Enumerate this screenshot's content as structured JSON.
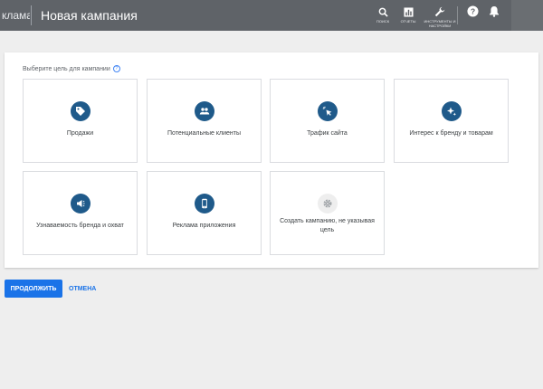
{
  "header": {
    "brand_partial": "клама",
    "title": "Новая кампания",
    "tools": [
      {
        "label": "поиск",
        "icon": "search-icon"
      },
      {
        "label": "отчеты",
        "icon": "reports-icon"
      },
      {
        "label": "инструменты и настройки",
        "icon": "wrench-icon"
      }
    ],
    "help_icon": "help-icon",
    "bell_icon": "bell-icon"
  },
  "main": {
    "prompt": "Выберите цель для кампании",
    "prompt_help": "?",
    "goals": [
      {
        "label": "Продажи",
        "icon": "tag-icon"
      },
      {
        "label": "Потенциальные клиенты",
        "icon": "people-icon"
      },
      {
        "label": "Трафик сайта",
        "icon": "cursor-click-icon"
      },
      {
        "label": "Интерес к бренду и товарам",
        "icon": "sparkle-icon"
      },
      {
        "label": "Узнаваемость бренда и охват",
        "icon": "megaphone-icon"
      },
      {
        "label": "Реклама приложения",
        "icon": "phone-icon"
      },
      {
        "label": "Создать кампанию, не указывая цель",
        "icon": "gear-icon"
      }
    ]
  },
  "actions": {
    "continue_label": "ПРОДОЛЖИТЬ",
    "cancel_label": "ОТМЕНА"
  },
  "colors": {
    "header_bg": "#5f6368",
    "goal_icon_bg": "#1f5a8a",
    "primary": "#1a73e8"
  }
}
